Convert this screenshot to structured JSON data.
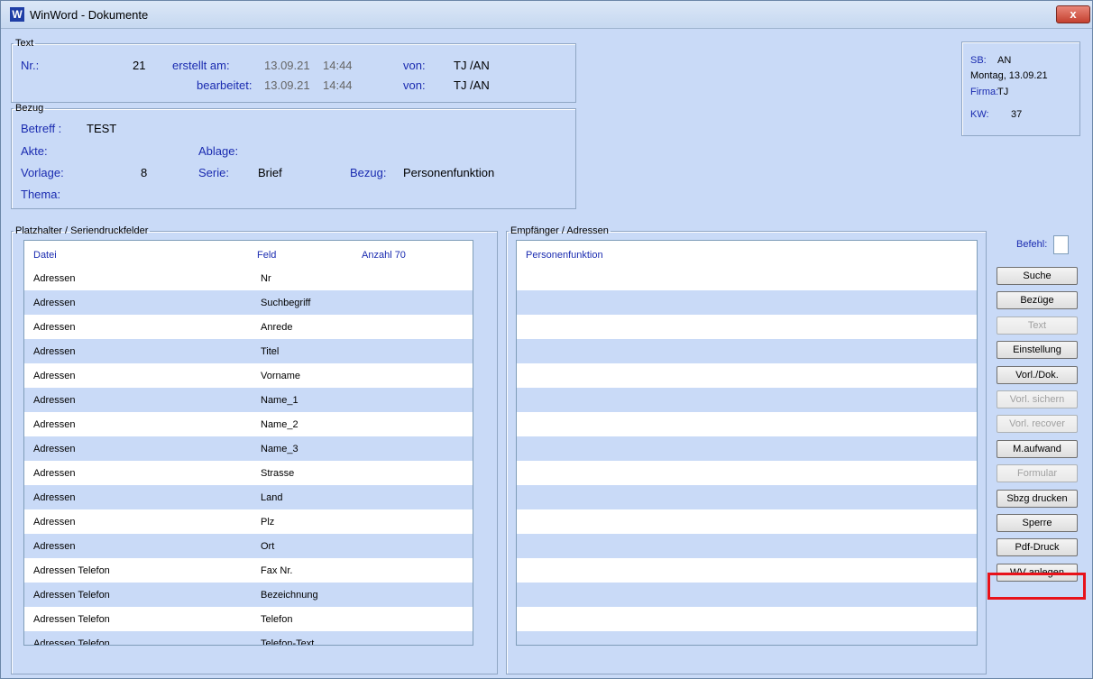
{
  "window": {
    "title": "WinWord - Dokumente",
    "close_glyph": "x"
  },
  "text_group": {
    "legend": "Text",
    "nr_label": "Nr.:",
    "nr_value": "21",
    "created_label": "erstellt am:",
    "created_date": "13.09.21",
    "created_time": "14:44",
    "created_by_label": "von:",
    "created_by": "TJ /AN",
    "edited_label": "bearbeitet:",
    "edited_date": "13.09.21",
    "edited_time": "14:44",
    "edited_by_label": "von:",
    "edited_by": "TJ /AN"
  },
  "bezug_group": {
    "legend": "Bezug",
    "betreff_label": "Betreff :",
    "betreff_value": "TEST",
    "akte_label": "Akte:",
    "ablage_label": "Ablage:",
    "vorlage_label": "Vorlage:",
    "vorlage_value": "8",
    "serie_label": "Serie:",
    "serie_value": "Brief",
    "bezug_label": "Bezug:",
    "bezug_value": "Personenfunktion",
    "thema_label": "Thema:"
  },
  "info_box": {
    "sb_label": "SB:",
    "sb_value": "AN",
    "date": "Montag, 13.09.21",
    "firma_label": "Firma:",
    "firma_value": "TJ",
    "kw_label": "KW:",
    "kw_value": "37"
  },
  "placeholder_group": {
    "legend": "Platzhalter / Seriendruckfelder",
    "headers": {
      "datei": "Datei",
      "feld": "Feld",
      "anzahl": "Anzahl 70"
    },
    "rows": [
      {
        "datei": "Adressen",
        "feld": "Nr"
      },
      {
        "datei": "Adressen",
        "feld": "Suchbegriff"
      },
      {
        "datei": "Adressen",
        "feld": "Anrede"
      },
      {
        "datei": "Adressen",
        "feld": "Titel"
      },
      {
        "datei": "Adressen",
        "feld": "Vorname"
      },
      {
        "datei": "Adressen",
        "feld": "Name_1"
      },
      {
        "datei": "Adressen",
        "feld": "Name_2"
      },
      {
        "datei": "Adressen",
        "feld": "Name_3"
      },
      {
        "datei": "Adressen",
        "feld": "Strasse"
      },
      {
        "datei": "Adressen",
        "feld": "Land"
      },
      {
        "datei": "Adressen",
        "feld": "Plz"
      },
      {
        "datei": "Adressen",
        "feld": "Ort"
      },
      {
        "datei": "Adressen Telefon",
        "feld": "Fax Nr."
      },
      {
        "datei": "Adressen Telefon",
        "feld": "Bezeichnung"
      },
      {
        "datei": "Adressen Telefon",
        "feld": "Telefon"
      },
      {
        "datei": "Adressen Telefon",
        "feld": "Telefon-Text"
      }
    ]
  },
  "recipients_group": {
    "legend": "Empfänger / Adressen",
    "header": "Personenfunktion"
  },
  "command": {
    "label": "Befehl:",
    "value": ""
  },
  "buttons": [
    {
      "label": "Suche",
      "enabled": true
    },
    {
      "label": "Bezüge",
      "enabled": true
    },
    {
      "label": "Text",
      "enabled": false
    },
    {
      "label": "Einstellung",
      "enabled": true
    },
    {
      "label": "Vorl./Dok.",
      "enabled": true
    },
    {
      "label": "Vorl. sichern",
      "enabled": false
    },
    {
      "label": "Vorl. recover",
      "enabled": false
    },
    {
      "label": "M.aufwand",
      "enabled": true
    },
    {
      "label": "Formular",
      "enabled": false
    },
    {
      "label": "Sbzg drucken",
      "enabled": true
    },
    {
      "label": "Sperre",
      "enabled": true
    },
    {
      "label": "Pdf-Druck",
      "enabled": true
    },
    {
      "label": "WV anlegen",
      "enabled": true,
      "highlighted": true
    }
  ],
  "colors": {
    "background": "#c9daf7",
    "label_blue": "#1a2bb0",
    "highlight_red": "#e8121a"
  }
}
